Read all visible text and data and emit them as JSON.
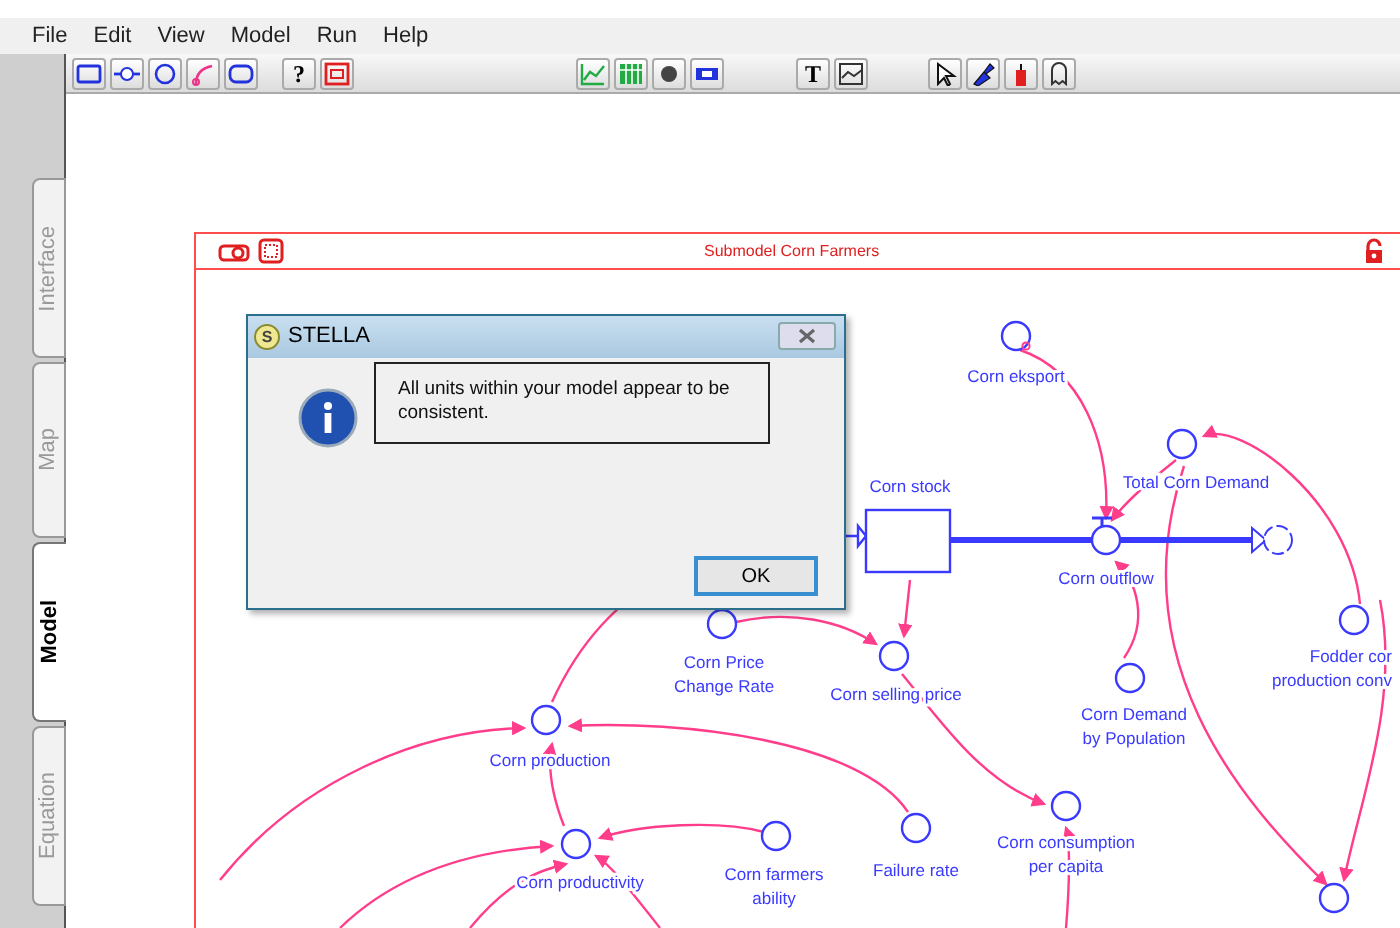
{
  "menu": [
    "File",
    "Edit",
    "View",
    "Model",
    "Run",
    "Help"
  ],
  "toolbar": {
    "help_glyph": "?",
    "text_glyph": "T"
  },
  "tabs": [
    {
      "label": "Interface",
      "selected": false
    },
    {
      "label": "Map",
      "selected": false
    },
    {
      "label": "Model",
      "selected": true
    },
    {
      "label": "Equation",
      "selected": false
    }
  ],
  "submodel": {
    "title": "Submodel Corn Farmers",
    "nodes": [
      {
        "kind": "converter",
        "label": [
          "Corn eksport"
        ]
      },
      {
        "kind": "stock",
        "label": [
          "Corn stock"
        ]
      },
      {
        "kind": "converter",
        "label": [
          "Total Corn Demand"
        ]
      },
      {
        "kind": "flow",
        "label": [
          "Corn outflow"
        ]
      },
      {
        "kind": "cloud"
      },
      {
        "kind": "converter",
        "label": [
          "Corn Price",
          "Change Rate"
        ]
      },
      {
        "kind": "converter",
        "label": [
          "Corn selling price"
        ]
      },
      {
        "kind": "converter",
        "label": [
          "Corn Demand",
          "by Population"
        ]
      },
      {
        "kind": "converter",
        "label": [
          "Fodder cor",
          "production conv"
        ]
      },
      {
        "kind": "converter",
        "label": [
          "Corn production"
        ]
      },
      {
        "kind": "converter",
        "label": [
          "Corn productivity"
        ]
      },
      {
        "kind": "converter",
        "label": [
          "Corn farmers",
          "ability"
        ]
      },
      {
        "kind": "converter",
        "label": [
          "Failure rate"
        ]
      },
      {
        "kind": "converter",
        "label": [
          "Corn consumption",
          "per capita"
        ]
      },
      {
        "kind": "converter"
      }
    ]
  },
  "dialog": {
    "title": "STELLA",
    "icon_letter": "S",
    "message": "All units within your model appear to be consistent.",
    "button": "OK"
  }
}
